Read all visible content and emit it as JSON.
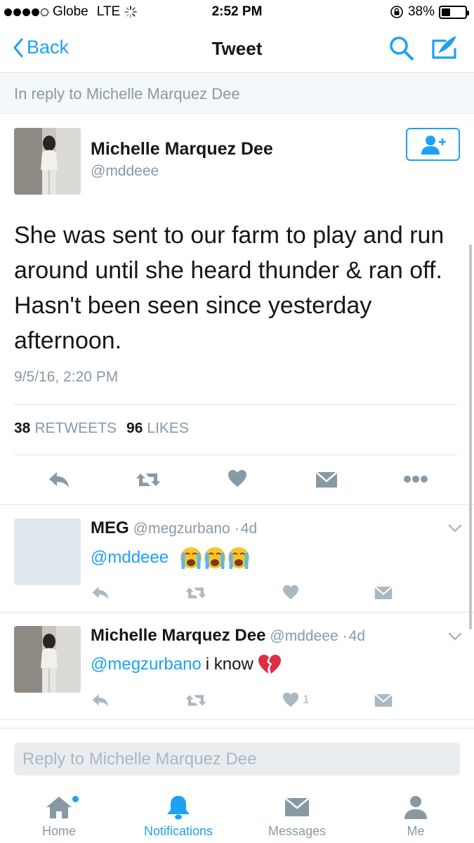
{
  "status_bar": {
    "carrier": "Globe",
    "network": "LTE",
    "time": "2:52 PM",
    "battery": "38%",
    "battery_level": 0.38
  },
  "nav": {
    "back_label": "Back",
    "title": "Tweet"
  },
  "in_reply_to": "In reply to Michelle Marquez Dee",
  "tweet": {
    "author_name": "Michelle Marquez Dee",
    "author_handle": "@mddeee",
    "text": "She was sent to our farm to play and run around until she heard thunder & ran off. Hasn't been seen since yesterday afternoon.",
    "date": "9/5/16, 2:20 PM",
    "retweets_count": "38",
    "retweets_label": "RETWEETS",
    "likes_count": "96",
    "likes_label": "LIKES"
  },
  "replies": [
    {
      "name": "MEG",
      "handle": "@megzurbano",
      "time": "4d",
      "mention": "@mddeee",
      "text": "",
      "emojis": [
        "crying-face",
        "crying-face",
        "crying-face"
      ],
      "like_count": ""
    },
    {
      "name": "Michelle Marquez Dee",
      "handle": "@mddeee",
      "time": "4d",
      "mention": "@megzurbano",
      "text": "i know",
      "emojis": [
        "broken-heart"
      ],
      "like_count": "1"
    }
  ],
  "reply_box": {
    "placeholder": "Reply to Michelle Marquez Dee"
  },
  "tabs": [
    {
      "label": "Home",
      "icon": "home-icon",
      "active": false,
      "badge": true
    },
    {
      "label": "Notifications",
      "icon": "bell-icon",
      "active": true,
      "badge": false
    },
    {
      "label": "Messages",
      "icon": "envelope-icon",
      "active": false,
      "badge": false
    },
    {
      "label": "Me",
      "icon": "person-icon",
      "active": false,
      "badge": false
    }
  ],
  "colors": {
    "accent": "#1da1f2",
    "muted": "#8899a6",
    "icon_gray": "#aab8c2",
    "text": "#14171a"
  }
}
